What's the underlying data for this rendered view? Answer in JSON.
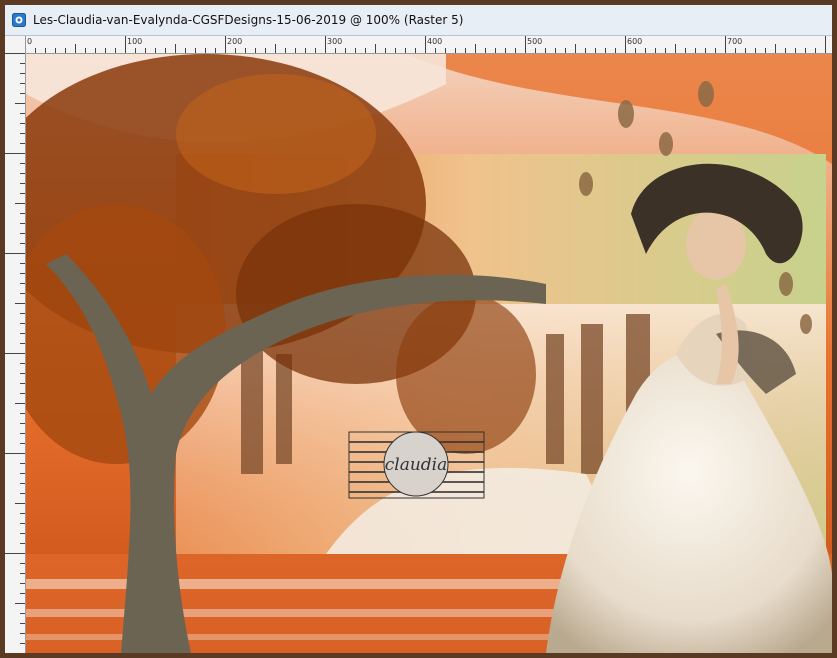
{
  "window": {
    "title": "Les-Claudia-van-Evalynda-CGSFDesigns-15-06-2019 @ 100% (Raster 5)",
    "app_icon": "paintshop-app-icon"
  },
  "ruler": {
    "top_labels": [
      "0",
      "100",
      "200",
      "300",
      "400",
      "500",
      "600",
      "700"
    ]
  },
  "canvas": {
    "watermark_text": "claudia",
    "layer_name": "Raster 5",
    "zoom": "100%",
    "colors": {
      "sky": "#f7e6d9",
      "orange": "#e9732f",
      "deep_orange": "#c94f17",
      "trunk": "#6b6452",
      "leaves": "#8a3a0a",
      "dress": "#efe7da",
      "hat": "#3b3127"
    }
  }
}
